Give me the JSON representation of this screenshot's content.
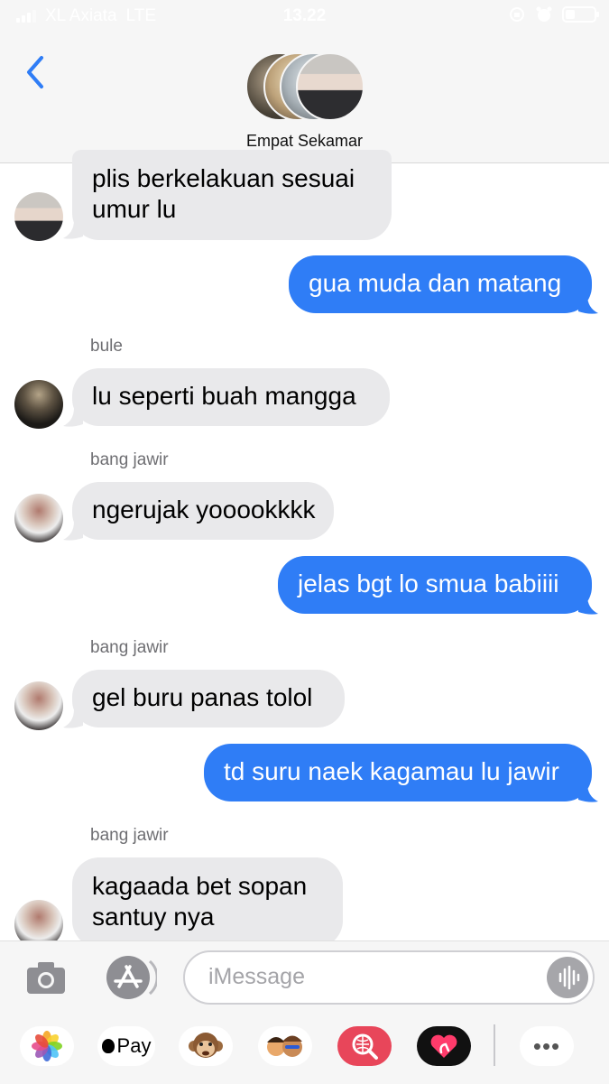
{
  "status_bar": {
    "carrier": "XL Axiata",
    "network": "LTE",
    "time": "13.22"
  },
  "header": {
    "group_name": "Empat Sekamar"
  },
  "messages": [
    {
      "direction": "incoming",
      "text_line1": "plis berkelakuan sesuai",
      "text_line2": "umur lu"
    },
    {
      "direction": "outgoing",
      "text": "gua muda dan matang"
    },
    {
      "direction": "incoming",
      "sender": "bule",
      "text": "lu seperti buah mangga"
    },
    {
      "direction": "incoming",
      "sender": "bang jawir",
      "text": "ngerujak yooookkkk"
    },
    {
      "direction": "outgoing",
      "text": "jelas bgt lo smua babiiii"
    },
    {
      "direction": "incoming",
      "sender": "bang jawir",
      "text": "gel buru panas tolol"
    },
    {
      "direction": "outgoing",
      "text": "td suru naek kagamau lu jawir"
    },
    {
      "direction": "incoming",
      "sender": "bang jawir",
      "text_line1": "kagaada bet sopan",
      "text_line2": "santuy nya"
    }
  ],
  "composer": {
    "placeholder": "iMessage"
  },
  "app_drawer": {
    "apple_pay_label": "Pay",
    "more_label": "•••"
  },
  "colors": {
    "outgoing_bubble": "#2f7df6",
    "incoming_bubble": "#e9e9eb",
    "accent": "#2f7df6"
  }
}
